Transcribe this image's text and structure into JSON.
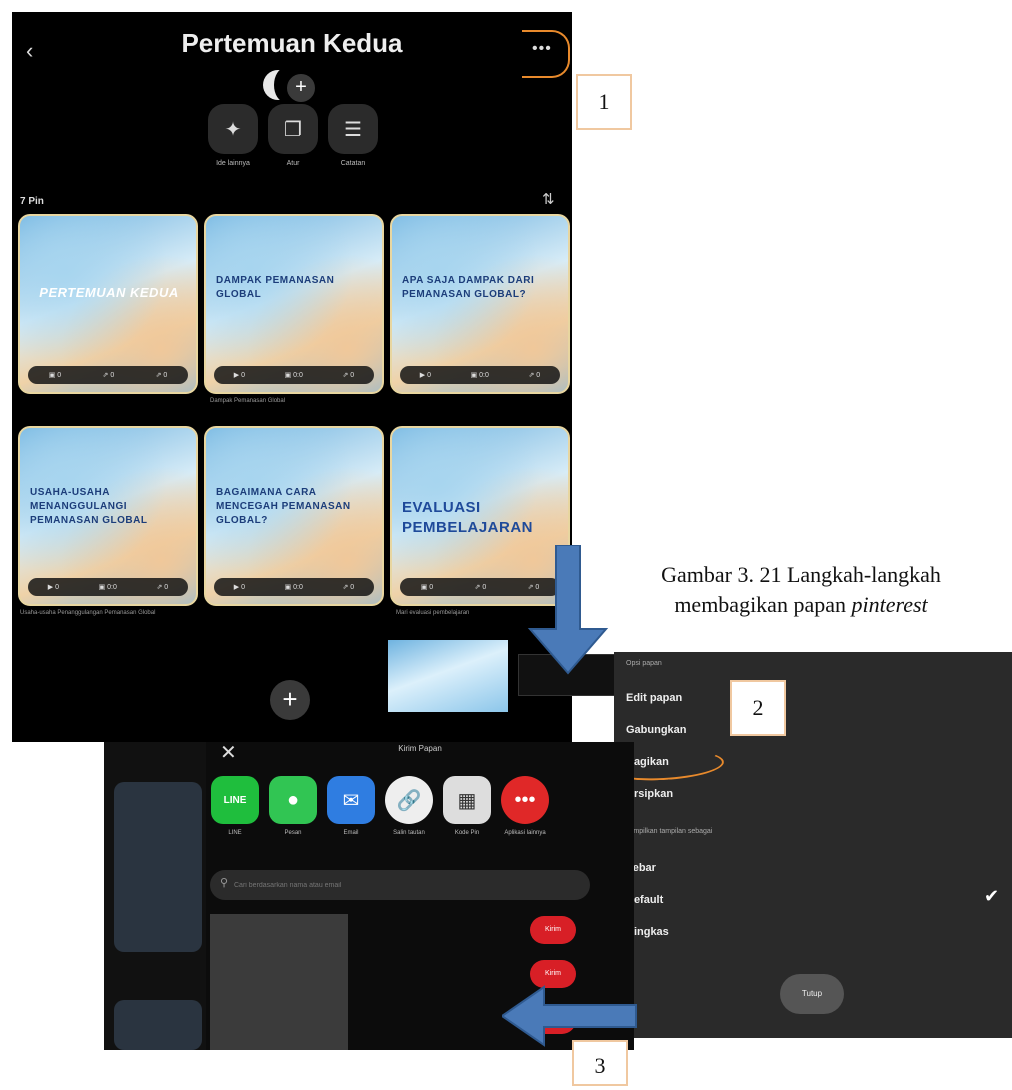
{
  "board": {
    "back_icon": "chevron-left-icon",
    "title": "Pertemuan Kedua",
    "add_collaborator": "+",
    "more": "•••"
  },
  "actions": [
    {
      "icon": "sparkle-icon",
      "label": "Ide lainnya"
    },
    {
      "icon": "organize-icon",
      "label": "Atur"
    },
    {
      "icon": "notes-icon",
      "label": "Catatan"
    }
  ],
  "pin_count": "7 Pin",
  "pins": [
    {
      "title": "PERTEMUAN Kedua",
      "caption": ""
    },
    {
      "title": "DAMPAK PEMANASAN GLOBAL",
      "caption": "Dampak Pemanasan Global"
    },
    {
      "title": "APA SAJA DAMPAK DARI PEMANASAN GLOBAL?",
      "caption": ""
    },
    {
      "title": "USAHA-USAHA MENANGGULANGI PEMANASAN GLOBAL",
      "caption": "Usaha-usaha Penanggulangan Pemanasan Global"
    },
    {
      "title": "BAGAIMANA CARA MENCEGAH PEMANASAN GLOBAL?",
      "caption": ""
    },
    {
      "title": "EVALUASI PEMBELAJARAN",
      "caption": "Mari evaluasi pembelajaran"
    }
  ],
  "add_pin": "+",
  "caption": {
    "line1": "Gambar 3. 21 Langkah-langkah",
    "line2_prefix": "membagikan papan ",
    "line2_italic": "pinterest"
  },
  "steps": [
    "1",
    "2",
    "3"
  ],
  "share_sheet": {
    "title": "Kirim Papan",
    "close": "✕",
    "apps": [
      {
        "label": "LINE",
        "color": "#1fbe3d",
        "icon": "line-icon"
      },
      {
        "label": "Pesan",
        "color": "#31c553",
        "icon": "message-icon"
      },
      {
        "label": "Email",
        "color": "#2f7de1",
        "icon": "mail-icon"
      },
      {
        "label": "Salin tautan",
        "color": "#eeeeee",
        "icon": "link-icon"
      },
      {
        "label": "Kode Pin",
        "color": "#dddddd",
        "icon": "qr-icon"
      },
      {
        "label": "Aplikasi lainnya",
        "color": "#e02828",
        "icon": "more-apps-icon"
      }
    ],
    "search_placeholder": "Cari berdasarkan nama atau email",
    "send_buttons": [
      "Kirim",
      "Kirim",
      "Kirim"
    ]
  },
  "menu": {
    "section1": "Opsi papan",
    "items1": [
      "Edit papan",
      "Gabungkan",
      "Bagikan",
      "Arsipkan"
    ],
    "section2": "Tampilkan tampilan sebagai",
    "items2": [
      "Lebar",
      "Default",
      "Ringkas"
    ],
    "selected": "Default",
    "close_label": "Tutup"
  },
  "colors": {
    "screen_bg": "#000000",
    "menu_bg": "#2a2a2a",
    "highlight": "#e88a2c",
    "arrow": "#4a7ab8",
    "send_red": "#d81f26"
  }
}
